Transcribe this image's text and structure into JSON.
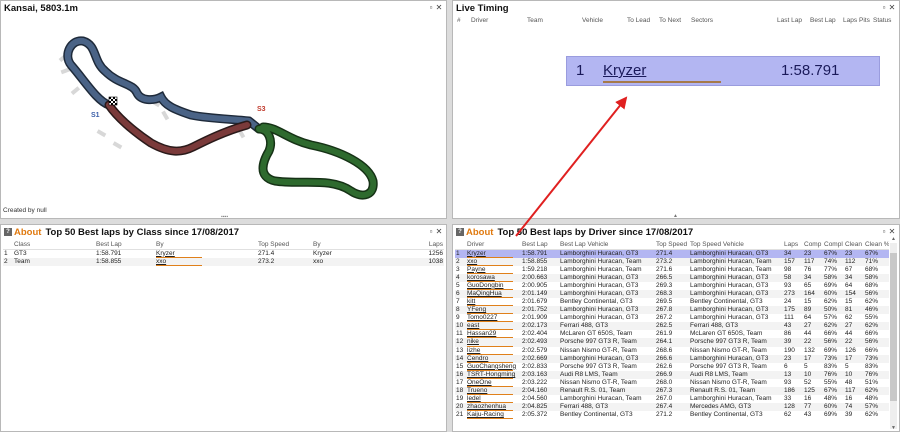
{
  "track_panel": {
    "title": "Kansai, 5803.1m",
    "credit": "Created by null",
    "sectors": [
      "S1",
      "S3"
    ],
    "colors": {
      "sector1": "#4a6386",
      "sector2": "#7a3a3a",
      "sector3": "#2e6a2e",
      "s1_label": "#3a5ea8",
      "s3_label": "#c0392b"
    }
  },
  "window_buttons": {
    "restore": "▫",
    "close": "✕"
  },
  "live_timing": {
    "title": "Live Timing",
    "headers": [
      "#",
      "Driver",
      "Team",
      "Vehicle",
      "To Lead",
      "To Next",
      "Sectors",
      "Last Lap",
      "Best Lap",
      "Laps",
      "Pits",
      "Status"
    ],
    "entry": {
      "pos": "1",
      "driver": "Kryzer",
      "time": "1:58.791"
    }
  },
  "class_panel": {
    "about": "About",
    "title": "Top 50 Best laps by Class since 17/08/2017",
    "headers": [
      "",
      "Class",
      "Best Lap",
      "By",
      "Top Speed",
      "By",
      "Laps"
    ],
    "rows": [
      [
        "1",
        "GT3",
        "1:58.791",
        "Kryzer",
        "271.4",
        "Kryzer",
        "1256"
      ],
      [
        "2",
        "Team",
        "1:58.855",
        "xxo",
        "273.2",
        "xxo",
        "1038"
      ]
    ]
  },
  "driver_panel": {
    "about": "About",
    "title": "Top 50 Best laps by Driver since 17/08/2017",
    "headers": [
      "",
      "Driver",
      "Best Lap",
      "Best Lap Vehicle",
      "Top Speed",
      "Top Speed Vehicle",
      "Laps",
      "Comp",
      "Compl",
      "Clean",
      "Clean %"
    ],
    "rows": [
      [
        "1",
        "Kryzer",
        "1:58.791",
        "Lamborghini Huracan, GT3",
        "271.4",
        "Lamborghini Huracan, GT3",
        "34",
        "23",
        "67%",
        "23",
        "67%"
      ],
      [
        "2",
        "xxo",
        "1:58.855",
        "Lamborghini Huracan, Team",
        "273.2",
        "Lamborghini Huracan, Team",
        "157",
        "117",
        "74%",
        "112",
        "71%"
      ],
      [
        "3",
        "Payne",
        "1:59.218",
        "Lamborghini Huracan, Team",
        "271.6",
        "Lamborghini Huracan, Team",
        "98",
        "76",
        "77%",
        "67",
        "68%"
      ],
      [
        "4",
        "korosawa",
        "2:00.663",
        "Lamborghini Huracan, GT3",
        "266.5",
        "Lamborghini Huracan, GT3",
        "58",
        "34",
        "58%",
        "34",
        "58%"
      ],
      [
        "5",
        "GuoDongbin",
        "2:00.905",
        "Lamborghini Huracan, GT3",
        "269.3",
        "Lamborghini Huracan, GT3",
        "93",
        "65",
        "69%",
        "64",
        "68%"
      ],
      [
        "6",
        "MaQingHua",
        "2:01.149",
        "Lamborghini Huracan, GT3",
        "268.3",
        "Lamborghini Huracan, GT3",
        "273",
        "164",
        "60%",
        "154",
        "56%"
      ],
      [
        "7",
        "kitt",
        "2:01.679",
        "Bentley Continental, GT3",
        "269.5",
        "Bentley Continental, GT3",
        "24",
        "15",
        "62%",
        "15",
        "62%"
      ],
      [
        "8",
        "YFeng",
        "2:01.752",
        "Lamborghini Huracan, GT3",
        "267.8",
        "Lamborghini Huracan, GT3",
        "175",
        "89",
        "50%",
        "81",
        "46%"
      ],
      [
        "9",
        "Tomo0227",
        "2:01.909",
        "Lamborghini Huracan, GT3",
        "267.2",
        "Lamborghini Huracan, GT3",
        "111",
        "64",
        "57%",
        "62",
        "55%"
      ],
      [
        "10",
        "east",
        "2:02.173",
        "Ferrari 488, GT3",
        "262.5",
        "Ferrari 488, GT3",
        "43",
        "27",
        "62%",
        "27",
        "62%"
      ],
      [
        "11",
        "Hassan29",
        "2:02.404",
        "McLaren GT 650S, Team",
        "261.9",
        "McLaren GT 650S, Team",
        "86",
        "44",
        "66%",
        "44",
        "66%"
      ],
      [
        "12",
        "nike",
        "2:02.493",
        "Porsche 997 GT3 R, Team",
        "264.1",
        "Porsche 997 GT3 R, Team",
        "39",
        "22",
        "56%",
        "22",
        "56%"
      ],
      [
        "13",
        "lizhe",
        "2:02.579",
        "Nissan Nismo GT-R, Team",
        "268.6",
        "Nissan Nismo GT-R, Team",
        "190",
        "132",
        "69%",
        "126",
        "66%"
      ],
      [
        "14",
        "Cendro",
        "2:02.669",
        "Lamborghini Huracan, GT3",
        "266.6",
        "Lamborghini Huracan, GT3",
        "23",
        "17",
        "73%",
        "17",
        "73%"
      ],
      [
        "15",
        "GuoChangsheng",
        "2:02.833",
        "Porsche 997 GT3 R, Team",
        "262.6",
        "Porsche 997 GT3 R, Team",
        "6",
        "5",
        "83%",
        "5",
        "83%"
      ],
      [
        "16",
        "TSRT-Hongming",
        "2:03.163",
        "Audi R8 LMS, Team",
        "266.9",
        "Audi R8 LMS, Team",
        "13",
        "10",
        "76%",
        "10",
        "76%"
      ],
      [
        "17",
        "OneOne",
        "2:03.222",
        "Nissan Nismo GT-R, Team",
        "268.0",
        "Nissan Nismo GT-R, Team",
        "93",
        "52",
        "55%",
        "48",
        "51%"
      ],
      [
        "18",
        "Trueno",
        "2:04.160",
        "Renault R.S. 01, Team",
        "267.3",
        "Renault R.S. 01, Team",
        "186",
        "125",
        "67%",
        "117",
        "62%"
      ],
      [
        "19",
        "ledel",
        "2:04.560",
        "Lamborghini Huracan, Team",
        "267.0",
        "Lamborghini Huracan, Team",
        "33",
        "16",
        "48%",
        "16",
        "48%"
      ],
      [
        "20",
        "zhaozhenhua",
        "2:04.825",
        "Ferrari 488, GT3",
        "267.4",
        "Mercedes AMG, GT3",
        "128",
        "77",
        "60%",
        "74",
        "57%"
      ],
      [
        "21",
        "Kaiju-Racing",
        "2:05.372",
        "Bentley Continental, GT3",
        "271.2",
        "Bentley Continental, GT3",
        "62",
        "43",
        "69%",
        "39",
        "62%"
      ]
    ]
  },
  "colors": {
    "highlight": "#b3b6f2",
    "accent": "#e07a10",
    "arrow": "#e02020"
  }
}
